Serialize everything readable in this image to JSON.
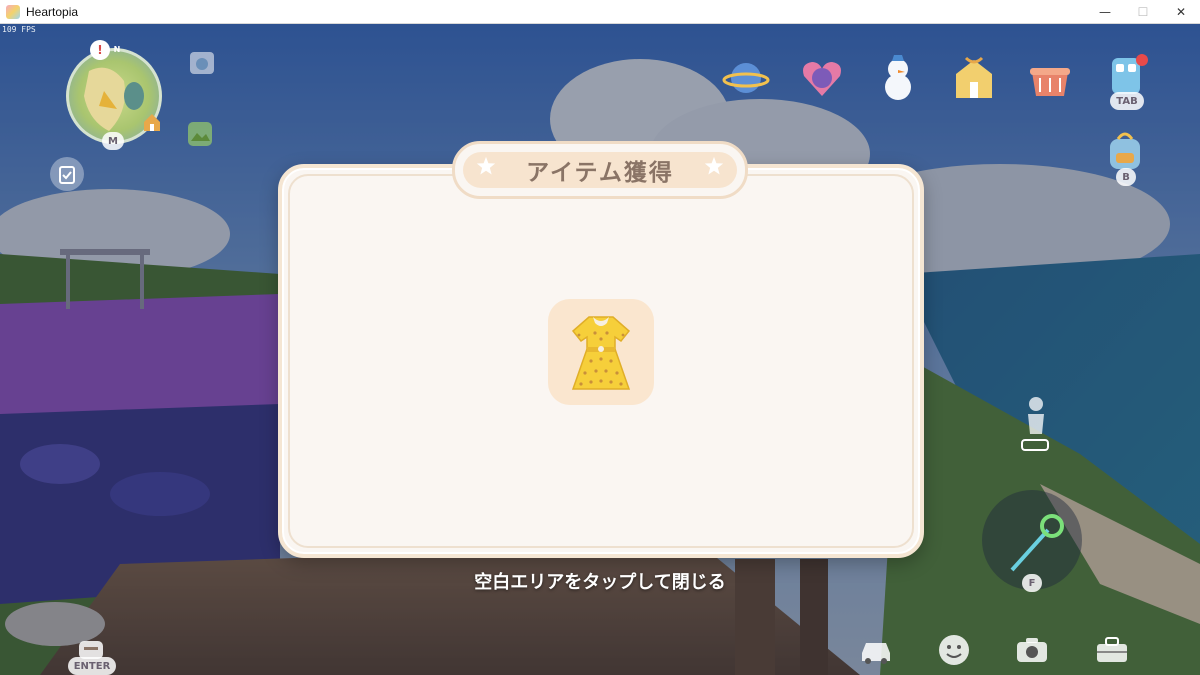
{
  "window": {
    "title": "Heartopia",
    "minimize_glyph": "—",
    "maximize_glyph": "☐",
    "close_glyph": "✕"
  },
  "hud": {
    "fps": "109 FPS",
    "minimap": {
      "map_key": "M",
      "north_label": "N"
    },
    "top_right_icons": [
      {
        "name": "planet-icon",
        "key": ""
      },
      {
        "name": "pony-heart-icon",
        "key": ""
      },
      {
        "name": "snowman-icon",
        "key": ""
      },
      {
        "name": "gift-shop-icon",
        "key": ""
      },
      {
        "name": "basket-icon",
        "key": ""
      },
      {
        "name": "phone-icon",
        "key": "TAB"
      }
    ],
    "backpack_key": "B",
    "enter_key": "ENTER",
    "tool_key": "F",
    "bottom_icons": [
      "car-icon",
      "smile-icon",
      "camera-icon",
      "toolbox-icon"
    ]
  },
  "dialog": {
    "title": "アイテム獲得",
    "item": {
      "name": "yellow-dress-icon",
      "colors": {
        "dress": "#f6cf3a",
        "dots": "#c9903a",
        "collar": "#f7efe2",
        "belt": "#e8b830"
      }
    },
    "close_hint": "空白エリアをタップして閉じる"
  },
  "colors": {
    "dialog_bg": "#faf6f2",
    "dialog_border": "#f5e6d3",
    "title_pill": "#f7e4cf",
    "title_text": "#8a7466",
    "item_slot": "#fae6cf"
  }
}
